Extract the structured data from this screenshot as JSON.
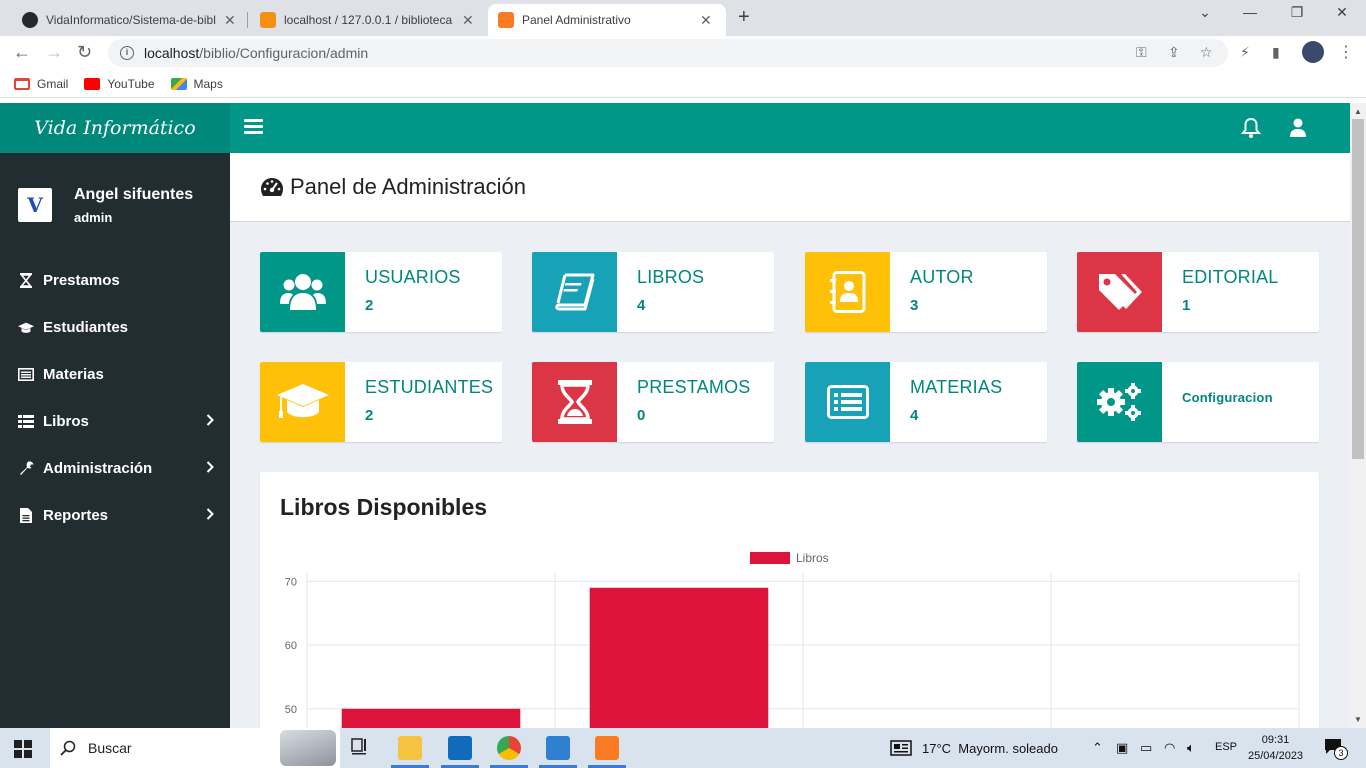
{
  "browser": {
    "tabs": [
      {
        "title": "VidaInformatico/Sistema-de-bibl",
        "active": false
      },
      {
        "title": "localhost / 127.0.0.1 / biblioteca |",
        "active": false
      },
      {
        "title": "Panel Administrativo",
        "active": true
      }
    ],
    "url_host": "localhost",
    "url_path": "/biblio/Configuracion/admin",
    "bookmarks": [
      "Gmail",
      "YouTube",
      "Maps"
    ]
  },
  "app": {
    "brand": "Vida Informático",
    "logo_letter": "V",
    "user_name": "Angel sifuentes",
    "user_role": "admin"
  },
  "sidebar": {
    "items": [
      {
        "label": "Prestamos",
        "icon": "hourglass-icon",
        "has_sub": false
      },
      {
        "label": "Estudiantes",
        "icon": "graduation-cap-icon",
        "has_sub": false
      },
      {
        "label": "Materias",
        "icon": "list-alt-icon",
        "has_sub": false
      },
      {
        "label": "Libros",
        "icon": "list-icon",
        "has_sub": true
      },
      {
        "label": "Administración",
        "icon": "wrench-icon",
        "has_sub": true
      },
      {
        "label": "Reportes",
        "icon": "file-icon",
        "has_sub": true
      }
    ]
  },
  "header": {
    "title": "Panel de Administración"
  },
  "cards": [
    {
      "label": "USUARIOS",
      "value": "2",
      "color": "#009688",
      "icon": "users-icon"
    },
    {
      "label": "LIBROS",
      "value": "4",
      "color": "#17a2b8",
      "icon": "book-icon"
    },
    {
      "label": "AUTOR",
      "value": "3",
      "color": "#ffc107",
      "icon": "address-book-icon"
    },
    {
      "label": "EDITORIAL",
      "value": "1",
      "color": "#dc3545",
      "icon": "tags-icon"
    },
    {
      "label": "ESTUDIANTES",
      "value": "2",
      "color": "#ffc107",
      "icon": "graduation-cap-icon"
    },
    {
      "label": "PRESTAMOS",
      "value": "0",
      "color": "#dc3545",
      "icon": "hourglass-icon"
    },
    {
      "label": "MATERIAS",
      "value": "4",
      "color": "#17a2b8",
      "icon": "list-alt-icon"
    },
    {
      "label": "Configuracion",
      "value": "",
      "color": "#009688",
      "icon": "cogs-icon"
    }
  ],
  "chart_title": "Libros Disponibles",
  "chart_data": {
    "type": "bar",
    "series": [
      {
        "name": "Libros",
        "values": [
          50,
          69,
          null,
          null
        ]
      }
    ],
    "categories": [
      "",
      "",
      "",
      ""
    ],
    "color": "#dc143c",
    "yticks": [
      50,
      60,
      70
    ],
    "ylim": [
      45,
      71
    ],
    "legend": "top-center",
    "grid": true
  },
  "taskbar": {
    "search_placeholder": "Buscar",
    "weather": "17°C  Mayorm. soleado",
    "lang": "ESP",
    "time": "09:31",
    "date": "25/04/2023",
    "notifications": "3"
  }
}
